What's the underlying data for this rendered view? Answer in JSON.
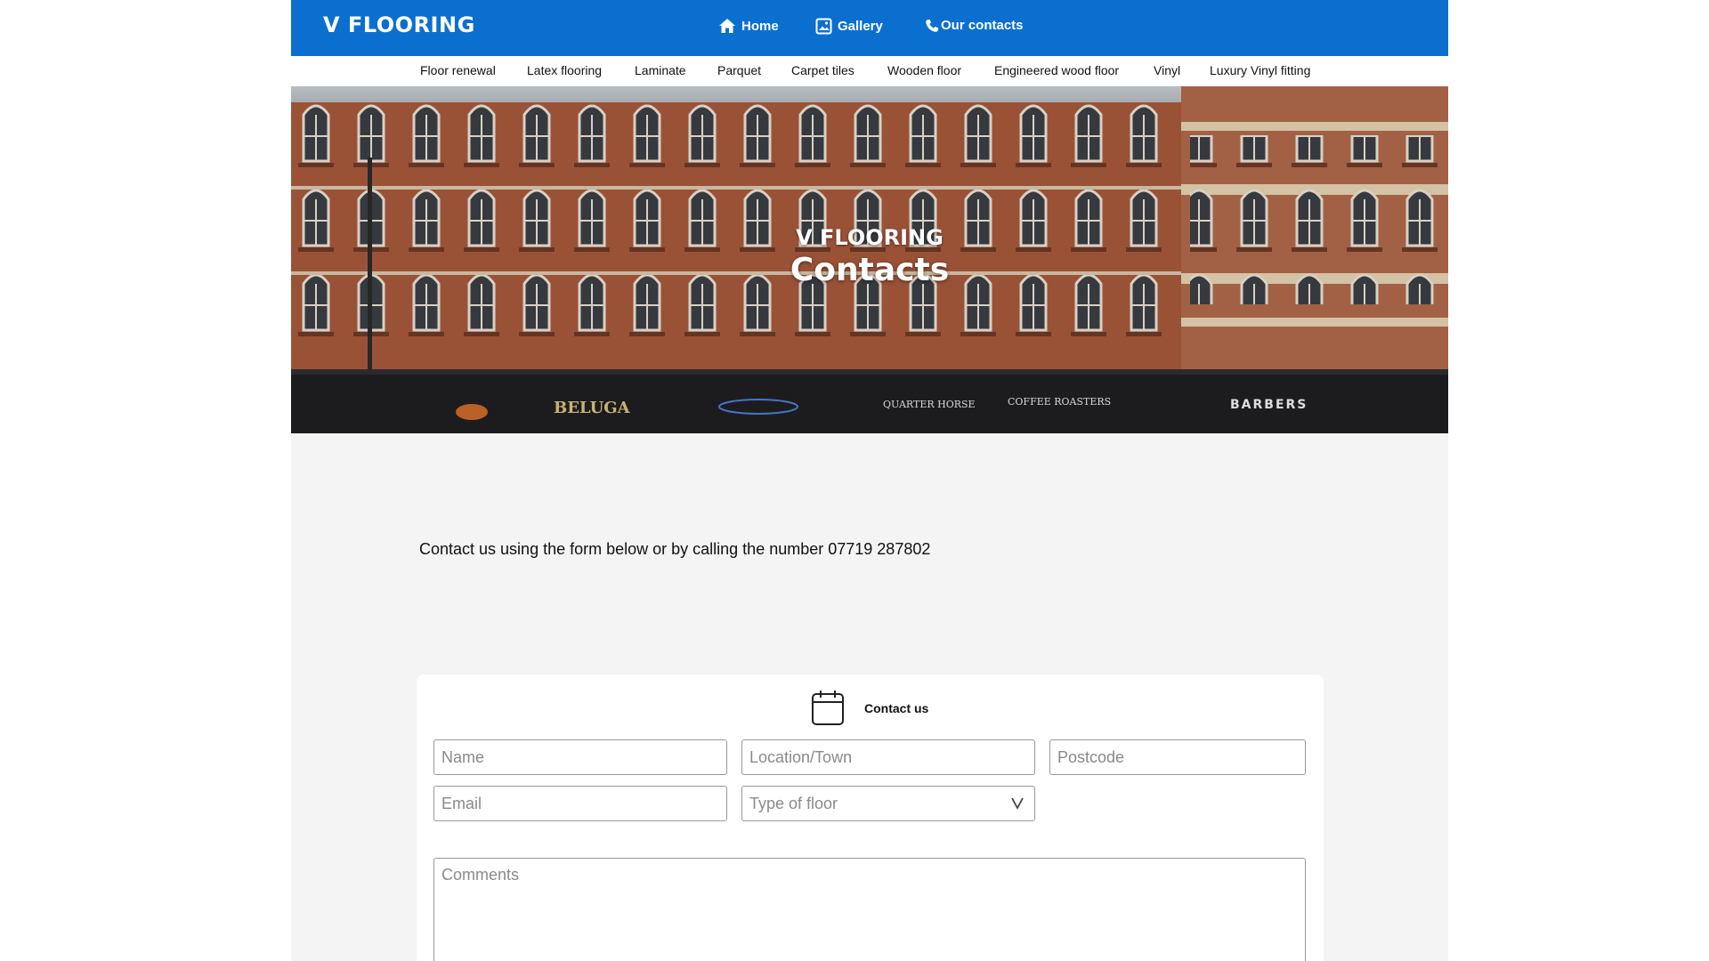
{
  "header": {
    "logo": "V FLOORING",
    "nav": [
      {
        "label": "Home",
        "icon": "home-icon"
      },
      {
        "label": "Gallery",
        "icon": "image-icon"
      },
      {
        "label": "Our contacts",
        "icon": "phone-icon"
      }
    ]
  },
  "subnav": {
    "items": [
      "Floor renewal",
      "Latex flooring",
      "Laminate",
      "Parquet",
      "Carpet tiles",
      "Wooden floor",
      "Engineered wood floor",
      "Vinyl",
      "Luxury Vinyl fitting"
    ]
  },
  "hero": {
    "brand": "V FLOORING",
    "title": "Contacts",
    "signs": [
      "BELUGA",
      "QUARTER HORSE",
      "COFFEE ROASTERS",
      "BARBERS"
    ]
  },
  "intro": {
    "text": "Contact us using the form below or by calling the number 07719 287802"
  },
  "form": {
    "title": "Contact us",
    "name_placeholder": "Name",
    "location_placeholder": "Location/Town",
    "postcode_placeholder": "Postcode",
    "email_placeholder": "Email",
    "floor_type_placeholder": "Type of floor",
    "comments_placeholder": "Comments"
  },
  "colors": {
    "brand_blue": "#0b6fd0",
    "page_bg": "#f4f4f4",
    "brick": "#a85a3c"
  }
}
